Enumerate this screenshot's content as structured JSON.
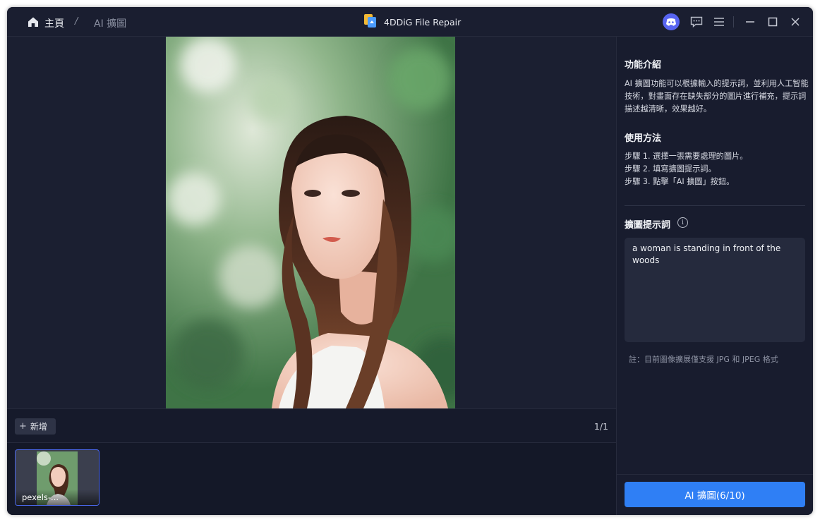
{
  "titlebar": {
    "breadcrumb_home": "主頁",
    "breadcrumb_separator": "/",
    "breadcrumb_current": "AI 擴圖",
    "app_title": "4DDiG File Repair",
    "icons": [
      "home-icon",
      "discord-icon",
      "feedback-icon",
      "menu-icon",
      "minimize-icon",
      "maximize-icon",
      "close-icon"
    ]
  },
  "toolbar": {
    "add_label": "新增",
    "page_indicator": "1/1"
  },
  "thumbnails": [
    {
      "label": "pexels-..."
    }
  ],
  "panel": {
    "intro_title": "功能介紹",
    "intro_text": "AI 擴圖功能可以根據輸入的提示詞，並利用人工智能技術，對畫面存在缺失部分的圖片進行補充，提示詞描述越清晰，效果越好。",
    "usage_title": "使用方法",
    "steps": [
      "步驟 1. 選擇一張需要處理的圖片。",
      "步驟 2. 填寫擴圖提示詞。",
      "步驟 3. 點擊「AI 擴圖」按鈕。"
    ],
    "prompt_title": "擴圖提示詞",
    "prompt_value": "a woman is standing in front of the woods",
    "note": "註：目前圖像擴展僅支援 JPG 和 JPEG 格式",
    "action_button": "AI 擴圖(6/10)"
  },
  "colors": {
    "accent": "#2f7ff5",
    "background": "#15192a",
    "panel": "#181c2e",
    "discord": "#5865f2"
  }
}
